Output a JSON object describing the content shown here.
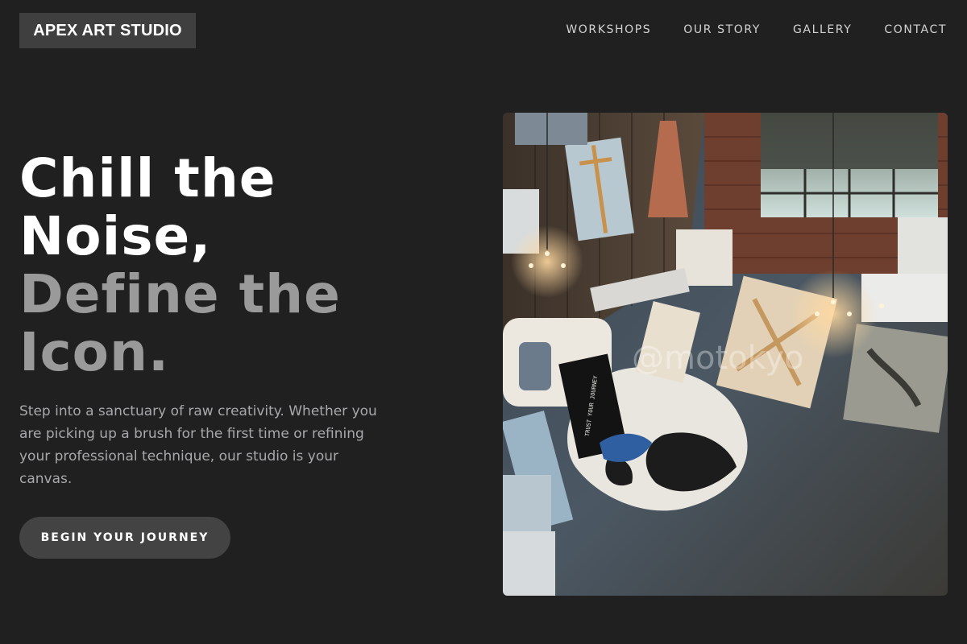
{
  "brand": {
    "name": "APEX ART STUDIO"
  },
  "nav": {
    "items": [
      "WORKSHOPS",
      "OUR STORY",
      "GALLERY",
      "CONTACT"
    ]
  },
  "hero": {
    "headline_line1": "Chill the",
    "headline_line2": "Noise,",
    "headline_line3": "Define the",
    "headline_line4": "Icon.",
    "description": "Step into a sanctuary of raw creativity. Whether you are picking up a brush for the first time or refining your professional technique, our studio is your canvas.",
    "cta_label": "BEGIN YOUR JOURNEY"
  },
  "image": {
    "alt": "Art studio loft with canvases, chandeliers and a cowhide rug",
    "sign_text": "TRUST YOUR JOURNEY",
    "watermark": "@motokyo"
  },
  "colors": {
    "background": "#202021",
    "logo_bg": "#3f3f3f",
    "headline_primary": "#ffffff",
    "headline_secondary": "#9a9a9a",
    "body_text": "#a8a8ab",
    "button_bg": "#434343"
  }
}
